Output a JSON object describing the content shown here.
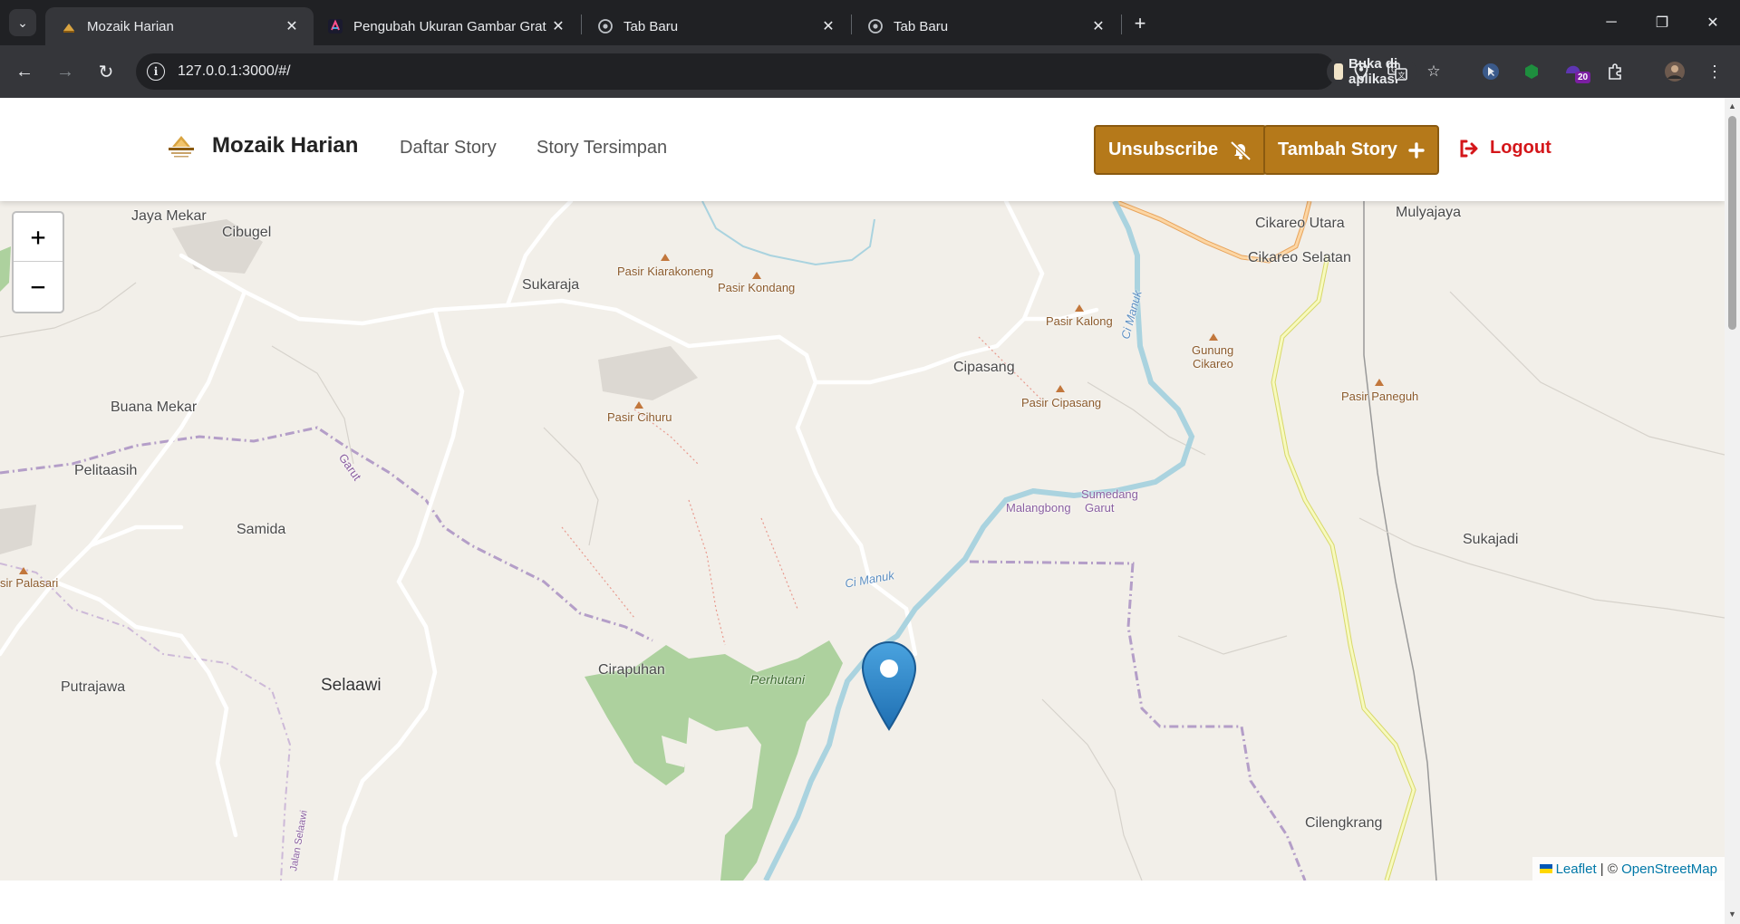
{
  "browser": {
    "tabs": [
      {
        "title": "Mozaik Harian",
        "active": true
      },
      {
        "title": "Pengubah Ukuran Gambar Grat",
        "active": false
      },
      {
        "title": "Tab Baru",
        "active": false
      },
      {
        "title": "Tab Baru",
        "active": false
      }
    ],
    "url": "127.0.0.1:3000/#/",
    "open_in_app_label": "Buka di aplikasi",
    "extension_badge": "20"
  },
  "app": {
    "brand_name": "Mozaik Harian",
    "nav": {
      "daftar_story": "Daftar Story",
      "story_tersimpan": "Story Tersimpan"
    },
    "buttons": {
      "unsubscribe": "Unsubscribe",
      "tambah_story": "Tambah Story",
      "logout": "Logout"
    },
    "colors": {
      "accent": "#b5791a",
      "logout": "#d4161a"
    }
  },
  "map": {
    "zoom_in": "+",
    "zoom_out": "−",
    "places": {
      "jaya_mekar": "Jaya Mekar",
      "cibugel": "Cibugel",
      "sukaraja": "Sukaraja",
      "buana_mekar": "Buana Mekar",
      "pelitaasih": "Pelitaasih",
      "samida": "Samida",
      "selaawi": "Selaawi",
      "putrajawa": "Putrajawa",
      "cirapuhan": "Cirapuhan",
      "cipasang": "Cipasang",
      "cikareo_utara": "Cikareo Utara",
      "cikareo_selatan": "Cikareo Selatan",
      "mulyajaya": "Mulyajaya",
      "sukajadi": "Sukajadi",
      "cilengkrang": "Cilengkrang"
    },
    "peaks": {
      "kiarakoneng": "Pasir Kiarakoneng",
      "kondang": "Pasir Kondang",
      "kalong": "Pasir Kalong",
      "gunung_cikareo_1": "Gunung",
      "gunung_cikareo_2": "Cikareo",
      "cipasang": "Pasir Cipasang",
      "paneguh": "Pasir Paneguh",
      "cihuru": "Pasir Cihuru",
      "palasari": "sir Palasari"
    },
    "rivers": {
      "cimanuk_north": "Ci Manuk",
      "cimanuk_south": "Ci Manuk"
    },
    "admin": {
      "sumedang": "Sumedang",
      "malangbong": "Malangbong",
      "garut_east": "Garut",
      "garut_west": "Garut",
      "selaawi_road": "Jalan Selaawi"
    },
    "forest": "Perhutani",
    "attribution": {
      "leaflet": "Leaflet",
      "separator": " | © ",
      "osm": "OpenStreetMap"
    }
  }
}
